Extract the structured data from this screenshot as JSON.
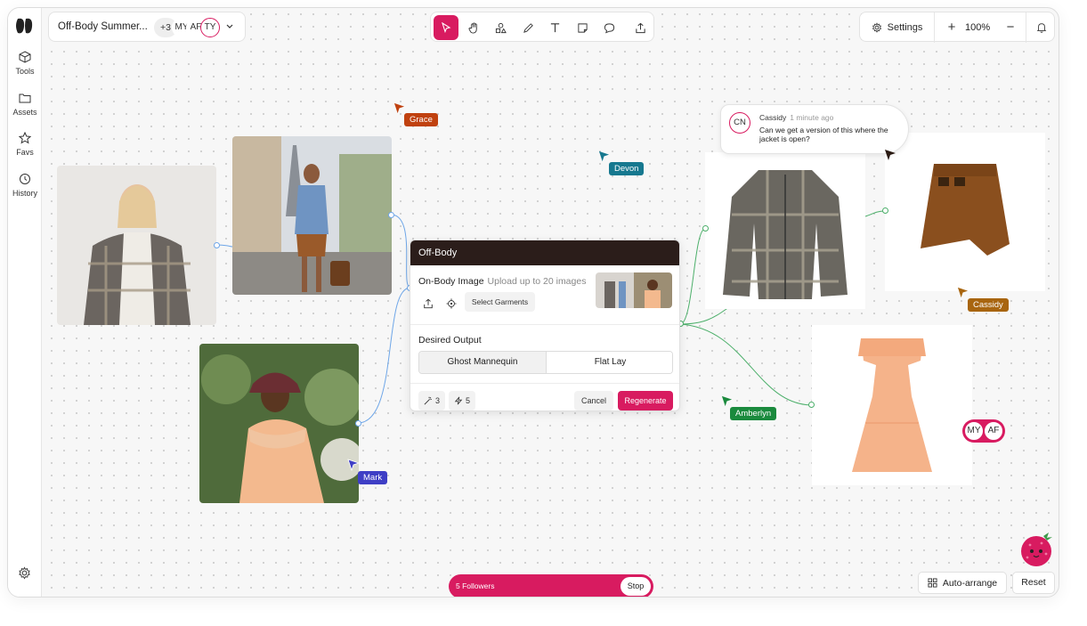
{
  "sidebar": {
    "items": [
      {
        "label": "Tools",
        "icon": "cube-icon"
      },
      {
        "label": "Assets",
        "icon": "folder-icon"
      },
      {
        "label": "Favs",
        "icon": "star-icon"
      },
      {
        "label": "History",
        "icon": "history-icon"
      }
    ]
  },
  "header": {
    "doc_title": "Off-Body Summer...",
    "more_collaborators": "+3",
    "collaborators": [
      "MY",
      "AF",
      "TY"
    ]
  },
  "toolbar": {
    "tools": [
      "select-icon",
      "hand-icon",
      "shapes-icon",
      "pencil-icon",
      "text-icon",
      "note-icon",
      "comment-icon",
      "share-icon"
    ],
    "active_tool": "select-icon"
  },
  "controls": {
    "settings_label": "Settings",
    "zoom_plus": "+",
    "zoom_value": "100%",
    "zoom_minus": "−"
  },
  "cursors": [
    {
      "name": "Grace",
      "color": "#c0410f"
    },
    {
      "name": "Devon",
      "color": "#16788f"
    },
    {
      "name": "Mark",
      "color": "#3e3ec5"
    },
    {
      "name": "Amberlyn",
      "color": "#1a8a3d"
    },
    {
      "name": "Cassidy",
      "color": "#a8650f"
    }
  ],
  "comment": {
    "initials": "CN",
    "author": "Cassidy",
    "time": "1 minute ago",
    "text": "Can we get a version of this where the jacket is open?"
  },
  "panel": {
    "title": "Off-Body",
    "onbody_label": "On-Body Image",
    "onbody_hint": "Upload up to 20 images",
    "select_garments": "Select Garments",
    "output_label": "Desired Output",
    "options": [
      "Ghost Mannequin",
      "Flat Lay"
    ],
    "selected_option": "Ghost Mannequin",
    "chip_variations": "3",
    "chip_credits": "5",
    "cancel": "Cancel",
    "regenerate": "Regenerate"
  },
  "avatar_pair": [
    "MY",
    "AF"
  ],
  "followers": {
    "text": "5 Followers",
    "stop": "Stop"
  },
  "bottom": {
    "auto_arrange": "Auto-arrange",
    "reset": "Reset"
  },
  "colors": {
    "accent": "#d81b60",
    "panel_header": "#2b1d1a",
    "connector_blue": "#6ea6e8",
    "connector_green": "#4caf6a"
  }
}
